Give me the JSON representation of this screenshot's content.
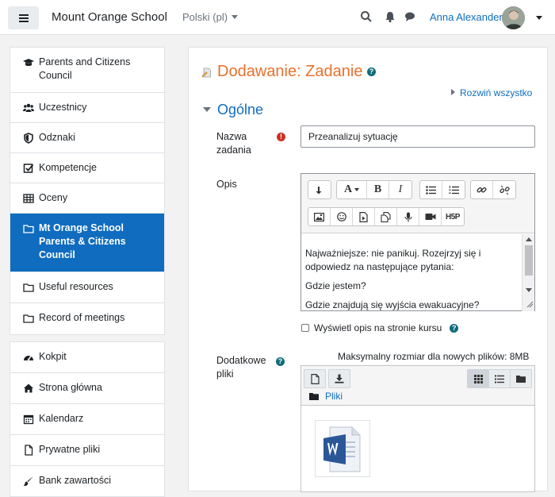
{
  "header": {
    "site_name": "Mount Orange School",
    "language": "Polski (pl)",
    "user_name": "Anna Alexander"
  },
  "sidebar": {
    "course_items": [
      {
        "label": "Parents and Citizens Council",
        "icon": "graduation-cap-icon"
      },
      {
        "label": "Uczestnicy",
        "icon": "users-icon"
      },
      {
        "label": "Odznaki",
        "icon": "shield-icon"
      },
      {
        "label": "Kompetencje",
        "icon": "checkbox-icon"
      },
      {
        "label": "Oceny",
        "icon": "table-icon"
      },
      {
        "label": "Mt Orange School Parents & Citizens Council",
        "icon": "folder-icon",
        "active": true
      },
      {
        "label": "Useful resources",
        "icon": "folder-icon"
      },
      {
        "label": "Record of meetings",
        "icon": "folder-icon"
      }
    ],
    "site_items": [
      {
        "label": "Kokpit",
        "icon": "dashboard-icon"
      },
      {
        "label": "Strona główna",
        "icon": "home-icon"
      },
      {
        "label": "Kalendarz",
        "icon": "calendar-icon"
      },
      {
        "label": "Prywatne pliki",
        "icon": "file-icon"
      },
      {
        "label": "Bank zawartości",
        "icon": "paintbrush-icon"
      }
    ]
  },
  "main": {
    "title": "Dodawanie: Zadanie",
    "expand_all": "Rozwiń wszystko",
    "section_title": "Ogólne",
    "name_label": "Nazwa zadania",
    "name_value": "Przeanalizuj sytuację",
    "description_label": "Opis",
    "editor_paragraphs": [
      "Najważniejsze: nie panikuj. Rozejrzyj się i odpowiedz na następujące pytania:",
      "Gdzie jestem?",
      "Gdzie znajdują się wyjścia ewakuacyjne?"
    ],
    "show_description_label": "Wyświetl opis na stronie kursu",
    "additional_files_label": "Dodatkowe pliki",
    "max_size_text": "Maksymalny rozmiar dla nowych plików: 8MB",
    "files_folder": "Pliki",
    "accent_color": "#e8712c",
    "link_color": "#0f6cbf"
  }
}
